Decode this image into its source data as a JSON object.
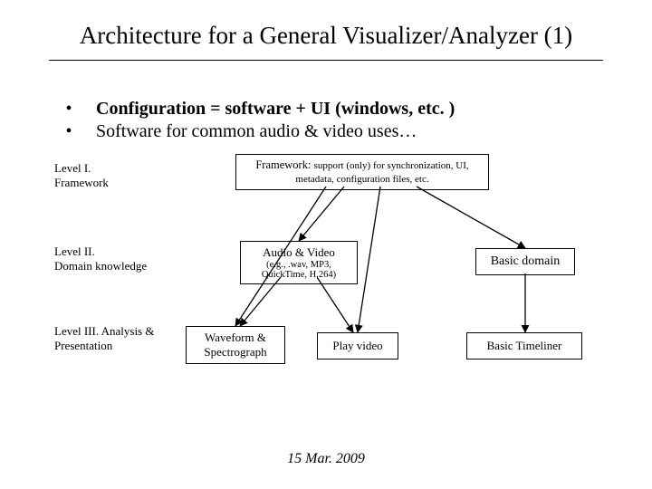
{
  "title": "Architecture for a General Visualizer/Analyzer (1)",
  "bullets": [
    "Configuration = software + UI (windows, etc. )",
    "Software for common audio & video uses…"
  ],
  "levels": {
    "l1": {
      "label_a": "Level I.",
      "label_b": "Framework"
    },
    "l2": {
      "label_a": "Level II.",
      "label_b": "Domain knowledge"
    },
    "l3": {
      "label_a": "Level III. Analysis &",
      "label_b": "Presentation"
    }
  },
  "nodes": {
    "framework": {
      "line1": "Framework:",
      "line2": "support (only) for synchronization, UI, metadata, configuration files, etc."
    },
    "audio_video": {
      "line1": "Audio & Video",
      "line2": "(e.g., .wav, MP3, QuickTime, H.264)"
    },
    "basic_domain": "Basic domain",
    "waveform": {
      "line1": "Waveform &",
      "line2": "Spectrograph"
    },
    "play_video": "Play video",
    "basic_timeliner": "Basic Timeliner"
  },
  "footer_date": "15 Mar. 2009"
}
